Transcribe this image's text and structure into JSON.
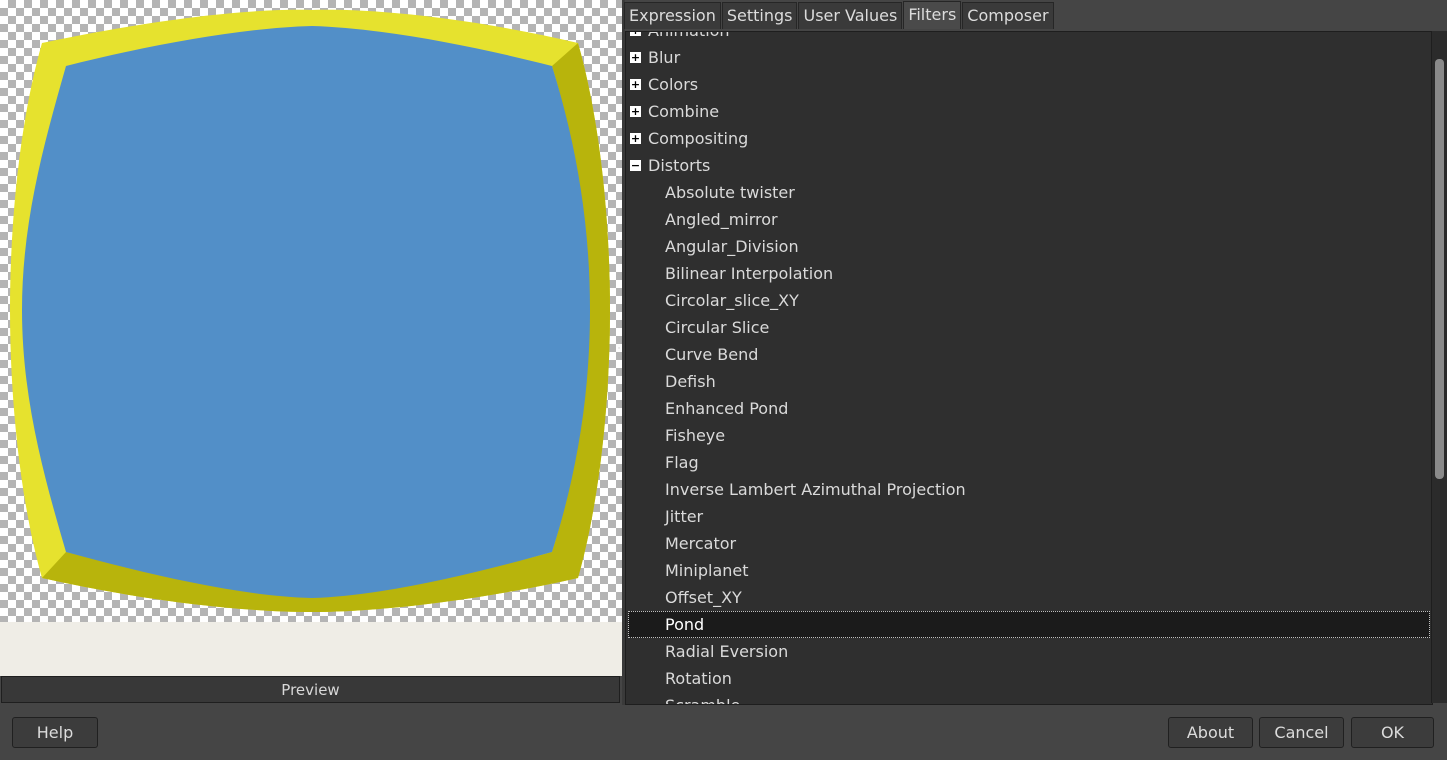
{
  "preview": {
    "label": "Preview"
  },
  "tabs": [
    "Expression",
    "Settings",
    "User Values",
    "Filters",
    "Composer"
  ],
  "active_tab": "Filters",
  "tree": {
    "categories_before": [
      {
        "label": "Animation",
        "expanded": false
      },
      {
        "label": "Blur",
        "expanded": false
      },
      {
        "label": "Colors",
        "expanded": false
      },
      {
        "label": "Combine",
        "expanded": false
      },
      {
        "label": "Compositing",
        "expanded": false
      }
    ],
    "expanded_category": {
      "label": "Distorts",
      "expanded": true
    },
    "items": [
      "Absolute twister",
      "Angled_mirror",
      "Angular_Division",
      "Bilinear Interpolation",
      "Circolar_slice_XY",
      "Circular Slice",
      "Curve Bend",
      "Defish",
      "Enhanced Pond",
      "Fisheye",
      "Flag",
      "Inverse Lambert Azimuthal Projection",
      "Jitter",
      "Mercator",
      "Miniplanet",
      "Offset_XY",
      "Pond",
      "Radial Eversion",
      "Rotation",
      "Scramble"
    ],
    "selected": "Pond"
  },
  "buttons": {
    "help": "Help",
    "about": "About",
    "cancel": "Cancel",
    "ok": "OK"
  },
  "colors": {
    "shape_fill": "#528fc8",
    "frame_yellow": "#e6e22e",
    "frame_dark": "#b5b10a"
  }
}
